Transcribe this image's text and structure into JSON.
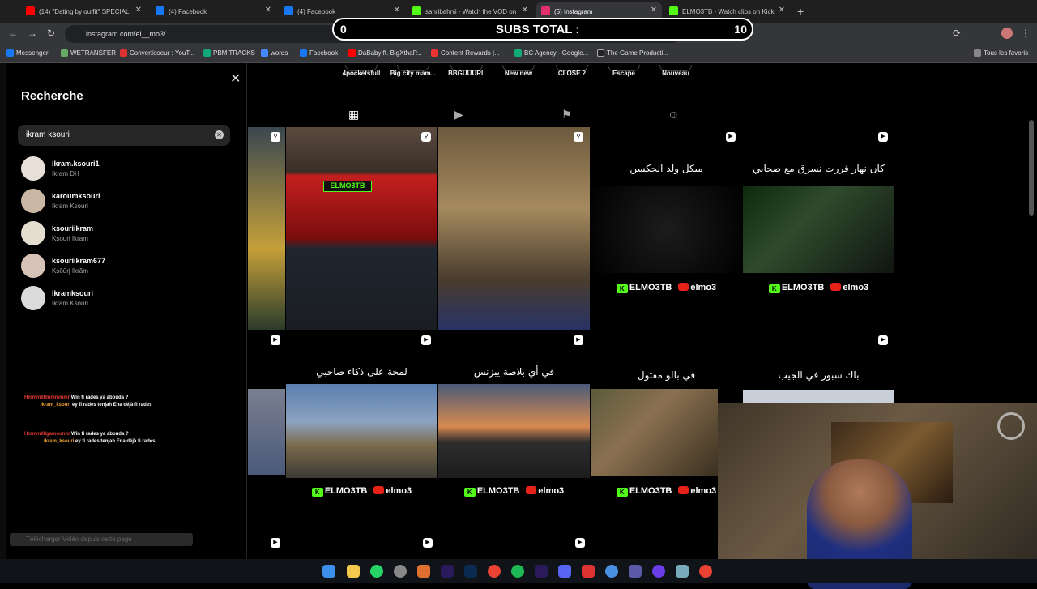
{
  "tabs": [
    {
      "label": "(14) \"Dating by outfit\" SPECIAL",
      "color": "#ff0000"
    },
    {
      "label": "(4) Facebook",
      "color": "#1877f2"
    },
    {
      "label": "(4) Facebook",
      "color": "#1877f2"
    },
    {
      "label": "sahribahnii - Watch the VOD on",
      "color": "#53fc18"
    },
    {
      "label": "(5) Instagram",
      "color": "#e1306c"
    },
    {
      "label": "ELMO3TB - Watch clips on Kick",
      "color": "#53fc18"
    }
  ],
  "url": "instagram.com/el__mo3/",
  "bookmarks": [
    "Messenger",
    "WETRANSFER",
    "Convertisseur : YouT...",
    "PBM TRACKS",
    "words",
    "Facebook",
    "DaBaby ft. BigXthaP...",
    "Content Rewards |...",
    "BC Agency - Google...",
    "The Game Producti...",
    "Tous les favoris"
  ],
  "subs": {
    "left": "0",
    "title": "SUBS TOTAL :",
    "right": "10"
  },
  "search": {
    "title": "Recherche",
    "query": "ikram ksouri",
    "results": [
      {
        "username": "ikram.ksouri1",
        "name": "Ikram DH"
      },
      {
        "username": "karoumksouri",
        "name": "Ikram Ksouri"
      },
      {
        "username": "ksouriikram",
        "name": "Ksouri Ikram"
      },
      {
        "username": "ksouriikram677",
        "name": "Ksõûrj Ikrãm"
      },
      {
        "username": "ikramksouri",
        "name": "Ikram Ksouri"
      }
    ]
  },
  "chat": [
    {
      "user": "Hmmmllllmmmmmr",
      "msg": "Win fi rades ya abouda ?",
      "reply_user": "ikram_ksouri",
      "reply": "ey fi rades tenjah Ena déjà fi rades"
    },
    {
      "user": "Hmmmllllgamoonnr",
      "msg": "Win fi rades ya abouda ?",
      "reply_user": "ikram_ksouri",
      "reply": "ey fi rades tenjah Ena déjà fi rades"
    }
  ],
  "download_label": "Télécharger Vidéo depuis cette page",
  "highlights": [
    "4pocketsfull",
    "Big city mam...",
    "BBGUUURL",
    "New new",
    "CLOSE 2",
    "Escape",
    "Nouveau"
  ],
  "posts_row1": [
    {
      "caption": "",
      "type": "pin"
    },
    {
      "caption": "",
      "type": "pin"
    },
    {
      "caption": "",
      "type": "pin"
    },
    {
      "caption": "ميكل ولد الجكسن",
      "type": "reel"
    },
    {
      "caption": "كان نهار قررت نسرق مع صحابي",
      "type": "reel"
    }
  ],
  "posts_row2": [
    {
      "caption": "لمحة على ذكاء صاحبي",
      "type": "reel"
    },
    {
      "caption": "في أي بلاصة يبزنس",
      "type": "reel"
    },
    {
      "caption": "في بالو مقتول",
      "type": "reel"
    },
    {
      "caption": "باك سبور في الجيب",
      "type": "reel"
    }
  ],
  "watermark": {
    "kick": "ELMO3TB",
    "yt": "elmo3"
  },
  "kick_badge": "ELMO3TB"
}
